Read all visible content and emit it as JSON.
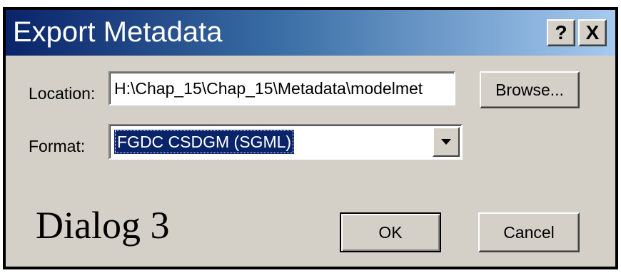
{
  "window": {
    "title": "Export Metadata",
    "help_button": "?",
    "close_button": "X",
    "colors": {
      "title_gradient_start": "#0a246a",
      "title_gradient_end": "#a6caf0",
      "face": "#d4d0c8",
      "selection": "#0a246a"
    }
  },
  "form": {
    "location_label": "Location:",
    "location_value": "H:\\Chap_15\\Chap_15\\Metadata\\modelmet",
    "format_label": "Format:",
    "format_selected": "FGDC CSDGM (SGML)"
  },
  "buttons": {
    "browse": "Browse...",
    "ok": "OK",
    "cancel": "Cancel"
  },
  "caption": "Dialog 3",
  "icons": {
    "dropdown": "chevron-down-icon",
    "help": "help-icon",
    "close": "close-icon"
  }
}
